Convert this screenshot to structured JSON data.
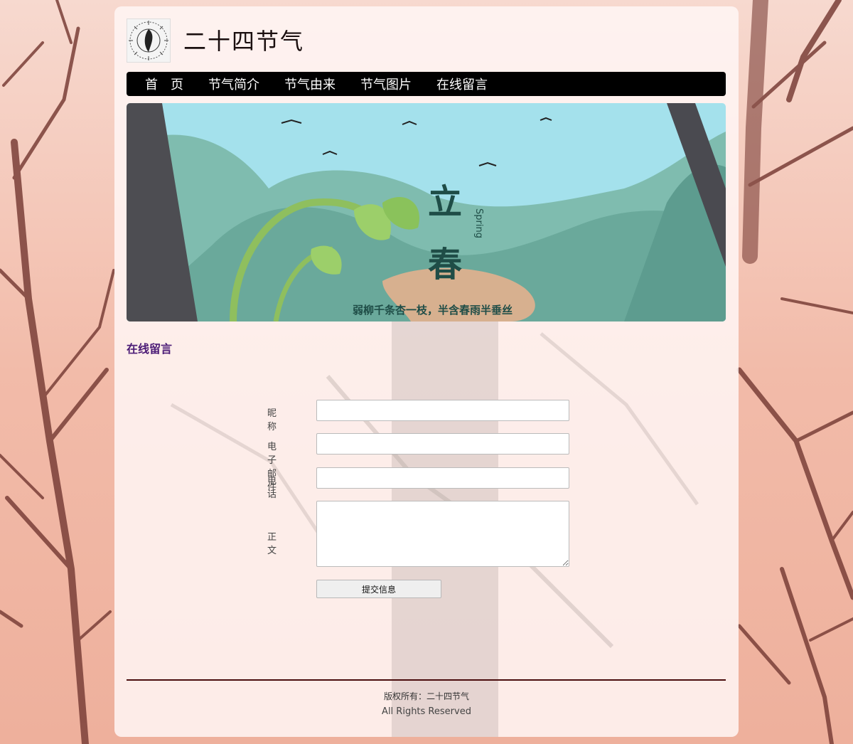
{
  "site": {
    "title": "二十四节气"
  },
  "nav": {
    "items": [
      "首　页",
      "节气简介",
      "节气由来",
      "节气图片",
      "在线留言"
    ]
  },
  "banner": {
    "title_char_1": "立",
    "title_char_2": "春",
    "english": "Spring",
    "poem": "弱柳千条杏一枝，半含春雨半垂丝"
  },
  "section": {
    "title": "在线留言"
  },
  "form": {
    "nickname_label": "昵称",
    "email_label": "电子邮件",
    "phone_label": "电话",
    "body_label": "正文",
    "nickname_value": "",
    "email_value": "",
    "phone_value": "",
    "body_value": "",
    "submit_label": "提交信息"
  },
  "footer": {
    "copyright": "版权所有：二十四节气",
    "rights": "All Rights Reserved"
  },
  "colors": {
    "nav_bg": "#000000",
    "section_title": "#4b1b76",
    "footer_rule": "#4a0d0d",
    "banner_sky": "#9fdfe9",
    "banner_hill": "#6fb2a4"
  }
}
